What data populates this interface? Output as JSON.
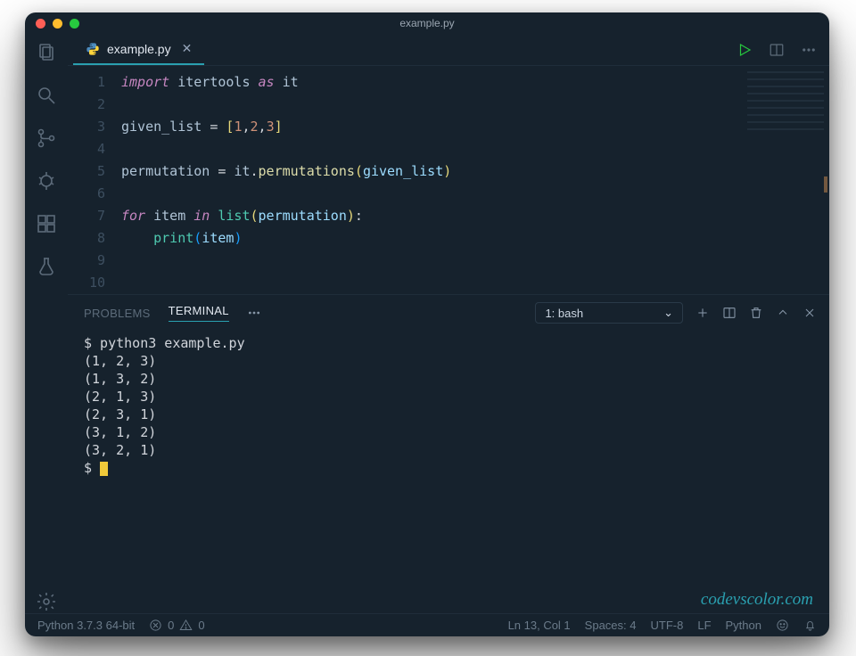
{
  "titlebar": {
    "title": "example.py"
  },
  "tab": {
    "filename": "example.py"
  },
  "code": {
    "lines": [
      {
        "n": 1,
        "html": "<span class='kw'>import</span> <span class='var'>itertools</span> <span class='kw'>as</span> <span class='var'>it</span>"
      },
      {
        "n": 2,
        "html": ""
      },
      {
        "n": 3,
        "html": "<span class='var'>given_list</span> = <span class='punct'>[</span><span class='num'>1</span>,<span class='num'>2</span>,<span class='num'>3</span><span class='punct'>]</span>"
      },
      {
        "n": 4,
        "html": ""
      },
      {
        "n": 5,
        "html": "<span class='var'>permutation</span> = <span class='var'>it</span>.<span class='call'>permutations</span><span class='punct'>(</span><span class='prop'>given_list</span><span class='punct'>)</span>"
      },
      {
        "n": 6,
        "html": ""
      },
      {
        "n": 7,
        "html": "<span class='kw'>for</span> <span class='var'>item</span> <span class='kw'>in</span> <span class='fn'>list</span><span class='punct'>(</span><span class='prop'>permutation</span><span class='punct'>)</span>:"
      },
      {
        "n": 8,
        "html": "    <span class='fn'>print</span><span class='paren1'>(</span><span class='prop'>item</span><span class='paren1'>)</span>"
      },
      {
        "n": 9,
        "html": ""
      },
      {
        "n": 10,
        "html": ""
      }
    ]
  },
  "panel": {
    "tabs": {
      "problems": "PROBLEMS",
      "terminal": "TERMINAL"
    },
    "terminal_select": "1: bash"
  },
  "terminal": {
    "lines": [
      "$ python3 example.py",
      "(1, 2, 3)",
      "(1, 3, 2)",
      "(2, 1, 3)",
      "(2, 3, 1)",
      "(3, 1, 2)",
      "(3, 2, 1)"
    ],
    "prompt": "$ "
  },
  "watermark": "codevscolor.com",
  "status": {
    "interpreter": "Python 3.7.3 64-bit",
    "errors": "0",
    "warnings": "0",
    "cursor": "Ln 13, Col 1",
    "spaces": "Spaces: 4",
    "encoding": "UTF-8",
    "eol": "LF",
    "lang": "Python"
  }
}
